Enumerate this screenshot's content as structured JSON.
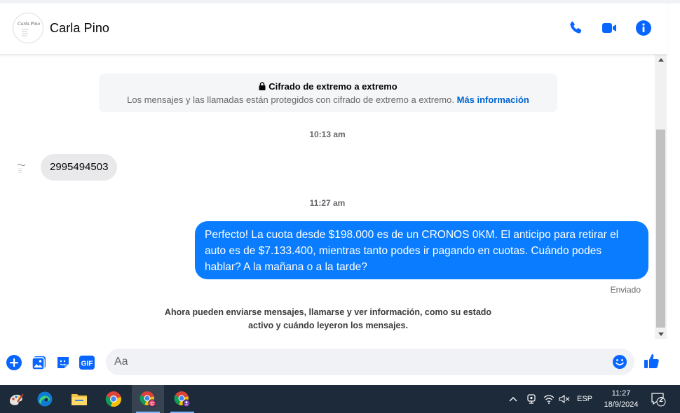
{
  "header": {
    "contact_name": "Carla Pino",
    "avatar_text": "Carla Pino"
  },
  "encryption": {
    "title": "Cifrado de extremo a extremo",
    "text": "Los mensajes y las llamadas están protegidos con cifrado de extremo a extremo.",
    "link": "Más información"
  },
  "conversation": {
    "time_1": "10:13 am",
    "incoming_message": "2995494503",
    "time_2": "11:27 am",
    "outgoing_message": "Perfecto! La cuota desde $198.000 es de un CRONOS 0KM. El anticipo para retirar el auto es de $7.133.400, mientras tanto podes ir pagando en cuotas. Cuándo podes hablar? A la mañana o a la tarde?",
    "sent_status": "Enviado",
    "info_text": "Ahora pueden enviarse mensajes, llamarse y ver información, como su estado activo y cuándo leyeron los mensajes."
  },
  "composer": {
    "placeholder": "Aa",
    "gif_label": "GIF"
  },
  "taskbar": {
    "language": "ESP",
    "time": "11:27",
    "date": "18/9/2024",
    "notification_count": "2"
  },
  "colors": {
    "messenger_blue": "#0a7cff",
    "icon_blue": "#0866ff",
    "taskbar_bg": "#1c2a3a"
  }
}
